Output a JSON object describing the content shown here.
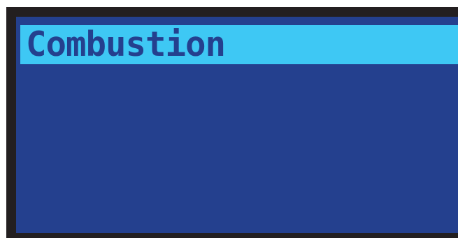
{
  "menu": {
    "selected_label": "Combustion"
  },
  "colors": {
    "frame": "#231f20",
    "panel": "#24408e",
    "highlight": "#3ec8f4",
    "label_text": "#24408e"
  }
}
